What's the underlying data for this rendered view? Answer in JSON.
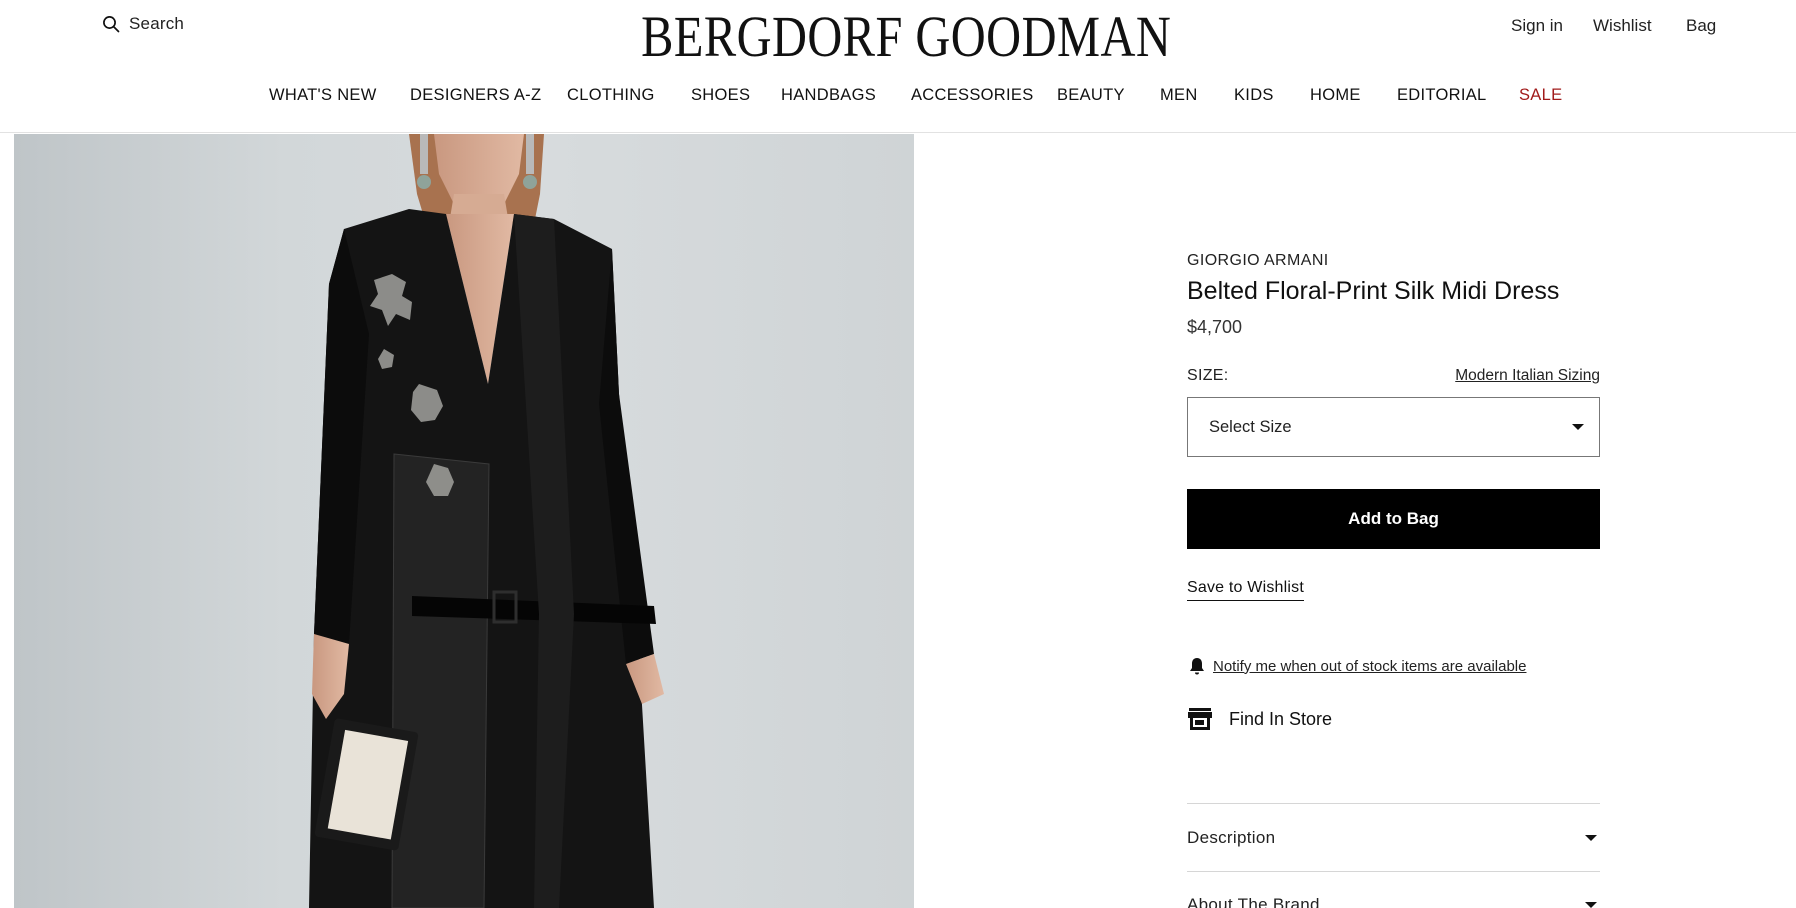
{
  "header": {
    "search_label": "Search",
    "logo_text": "BERGDORF GOODMAN",
    "util": {
      "signin": "Sign in",
      "wishlist": "Wishlist",
      "bag": "Bag"
    },
    "nav": [
      {
        "label": "WHAT'S NEW"
      },
      {
        "label": "DESIGNERS A-Z"
      },
      {
        "label": "CLOTHING"
      },
      {
        "label": "SHOES"
      },
      {
        "label": "HANDBAGS"
      },
      {
        "label": "ACCESSORIES"
      },
      {
        "label": "BEAUTY"
      },
      {
        "label": "MEN"
      },
      {
        "label": "KIDS"
      },
      {
        "label": "HOME"
      },
      {
        "label": "EDITORIAL"
      },
      {
        "label": "SALE"
      }
    ]
  },
  "product": {
    "brand": "GIORGIO ARMANI",
    "title": "Belted Floral-Print Silk Midi Dress",
    "price": "$4,700",
    "size_label": "SIZE:",
    "sizing_link": "Modern Italian Sizing",
    "size_select": {
      "selected": "Select Size"
    },
    "add_to_bag": "Add to Bag",
    "save_to_wishlist": "Save to Wishlist",
    "notify": "Notify me when out of stock items are available",
    "find_in_store": "Find In Store",
    "accordions": [
      {
        "label": "Description"
      },
      {
        "label": "About The Brand"
      }
    ]
  },
  "colors": {
    "sale": "#a11b1b",
    "button": "#000000",
    "image_bg": "#d2d7d9"
  },
  "icons": [
    "search-icon",
    "chevron-down-icon",
    "bell-icon",
    "store-icon"
  ]
}
